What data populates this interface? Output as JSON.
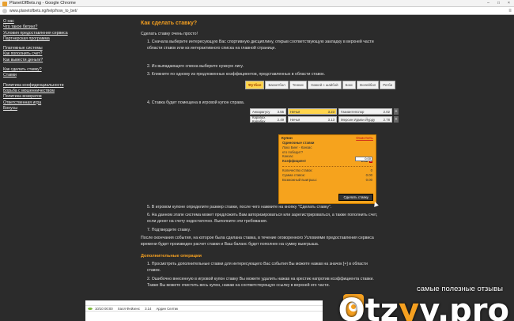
{
  "browser": {
    "title": "PlanetOfBets.ng - Google Chrome",
    "url": "www.planetofbets.ng/help/how_to_bet/",
    "buttons": {
      "minimize": "–",
      "maximize": "□",
      "close": "×",
      "menu": "≡"
    }
  },
  "sidebar": {
    "groups": [
      [
        "О нас",
        "Что такое бетинг?",
        "Условия предоставления сервиса",
        "Партнерская программа"
      ],
      [
        "Платежные системы",
        "Как пополнить счет?",
        "Как вывести деньги?"
      ],
      [
        "Как сделать ставку?",
        "Ставки"
      ],
      [
        "Политика конфиденциальности",
        "Борьба с мошенничеством",
        "Политика возвратов",
        "Ответственная игра",
        "Бонусы"
      ]
    ]
  },
  "main": {
    "heading": "Как сделать ставку?",
    "intro": "Сделать ставку очень просто!",
    "step1": "1. Сначала выберите интересующую Вас спортивную дисциплину, открыв соответствующую закладку в верхней части области ставок или из интерактивного списка на главной странице.",
    "step2": "2. Из выпадающего списка выберите нужную лигу.",
    "step3": "3. Кликните по одному из предложенных коэффициентов, представленных в области ставок.",
    "step4": "4. Ставка будет помещена в игровой купон справа.",
    "step5": "5. В игровом купоне определите размер ставки, после чего нажмите на кнопку \"Сделать ставку\".",
    "step6": "6. На данном этапе система может предложить Вам авторизироваться или зарегистрироваться, а также пополнить счет, если денег на счету недостаточно. Выполните эти требования.",
    "step7": "7. Подтвердите ставку.",
    "after": "После окончания события, на которое была сделана ставка, в течение оговоренного Условиями предоставления сервиса времени будет произведен расчет ставки и Ваш баланс будет пополнен на сумму выигрыша.",
    "extra_heading": "Дополнительные операции",
    "extra1": "1. Просмотреть дополнительные ставки для интересующего Вас события Вы можете нажав на значок [+] в области ставок.",
    "extra2": "2. Ошибочно внесенную в игровой купон ставку Вы можете удалить нажав на крестик напротив коэффициента ставки. Также Вы можете очистить весь купон, нажав на соответствующую ссылку в верхней его части."
  },
  "sport_tabs": [
    "Футбол",
    "Баскетбол",
    "Теннис",
    "Хоккей с шайбой",
    "Бокс",
    "Волейбол",
    "Регби"
  ],
  "odds": {
    "row1": [
      {
        "name": "Анкарагусу",
        "value": "3.55"
      },
      {
        "name": "Ничья",
        "value": "3.23"
      },
      {
        "name": "Газиантепспор",
        "value": "2.02"
      }
    ],
    "row2": [
      {
        "name": "Карабах Карабах",
        "value": "2.49"
      },
      {
        "name": "Ничья",
        "value": "3.13"
      },
      {
        "name": "Мерсин Идман Йурду",
        "value": "2.78"
      }
    ],
    "plus": "+"
  },
  "coupon": {
    "title": "Купон",
    "clear": "Очистить",
    "single": "Одиночные ставки",
    "event": "Локо Бинг - Канзас",
    "question": "кто победит?",
    "stake_value": "0.00",
    "outcome": "Канзас",
    "coef_label": "Коэффициент",
    "coef_value": "2.11",
    "remove": "×",
    "count_label": "Количество ставок:",
    "count_value": "0",
    "sum_label": "Сумма ставок:",
    "sum_value": "0.00",
    "win_label": "Возможный выигрыш:",
    "win_value": "0.00",
    "submit": "Сделать ставку"
  },
  "ticker": [
    {
      "date": "10/10 00:00",
      "home": "Халл Фейзенс",
      "odd": "3.14",
      "away": "Ардин Селтик"
    }
  ],
  "watermark": {
    "caption": "самые полезные отзывы",
    "logo_a": "Otz",
    "logo_b": "y",
    "logo_c": "v.pro"
  },
  "colors": {
    "accent": "#f5a020",
    "coupon": "#f6a31d",
    "highlight": "#ffd54d",
    "background": "#2b2b2b"
  }
}
